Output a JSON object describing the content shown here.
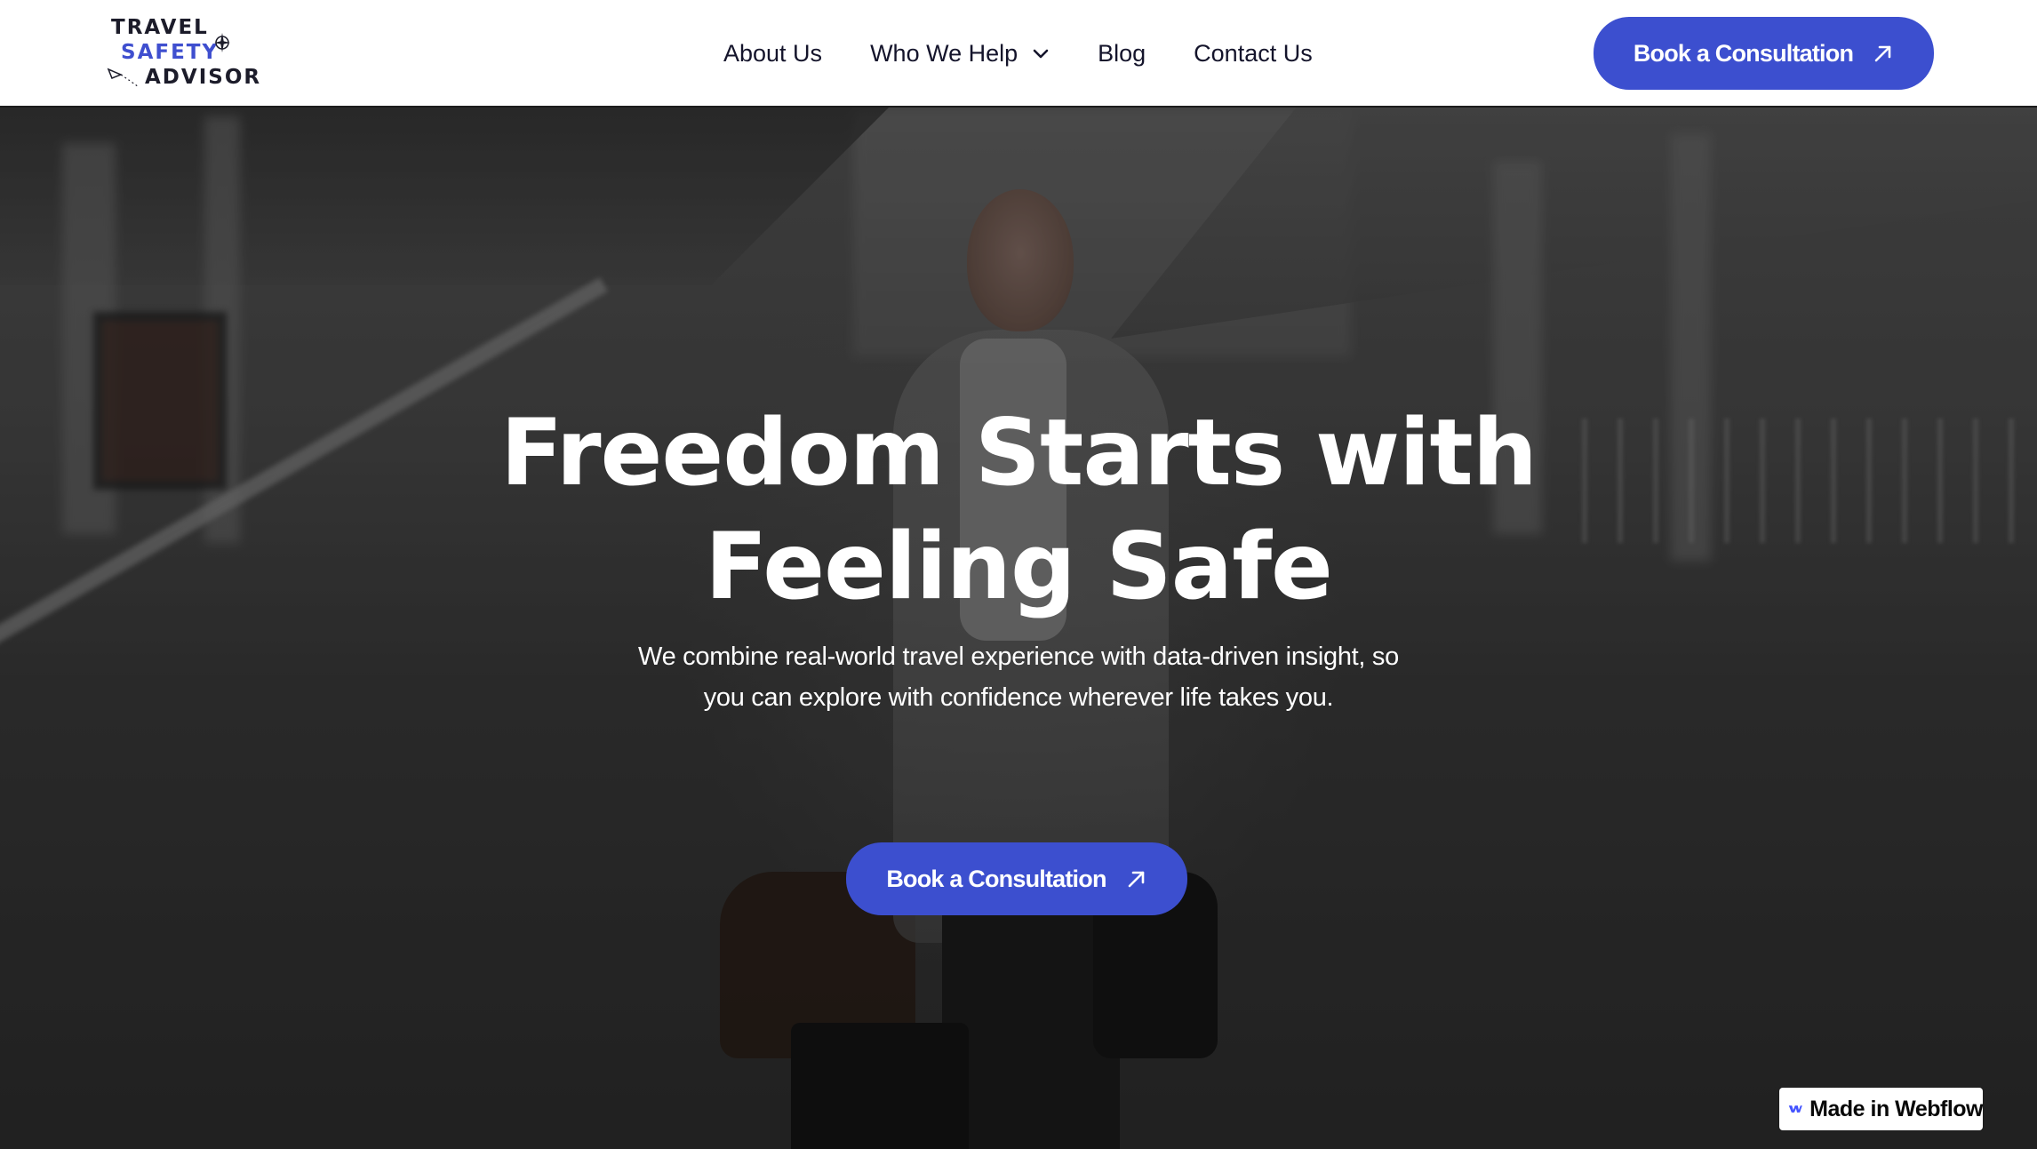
{
  "logo": {
    "line1": "TRAVEL",
    "line2": "SAFETY",
    "line3": "ADVISOR"
  },
  "nav": {
    "items": [
      {
        "label": "About Us"
      },
      {
        "label": "Who We Help",
        "has_dropdown": true
      },
      {
        "label": "Blog"
      },
      {
        "label": "Contact Us"
      }
    ],
    "cta_label": "Book a Consultation"
  },
  "hero": {
    "title_line1": "Freedom Starts with",
    "title_line2": "Feeling Safe",
    "subtitle_line1": "We combine real-world travel experience with data-driven insight, so",
    "subtitle_line2": "you can explore with confidence wherever life takes you.",
    "cta_label": "Book a Consultation"
  },
  "badge": {
    "label": "Made in Webflow"
  },
  "colors": {
    "accent": "#3c4fcf",
    "nav_text": "#14142b",
    "hero_text": "#ffffff"
  },
  "icons": {
    "chevron": "chevron-down-icon",
    "cta_arrow": "arrow-up-right-icon",
    "badge": "webflow-logo-icon"
  }
}
